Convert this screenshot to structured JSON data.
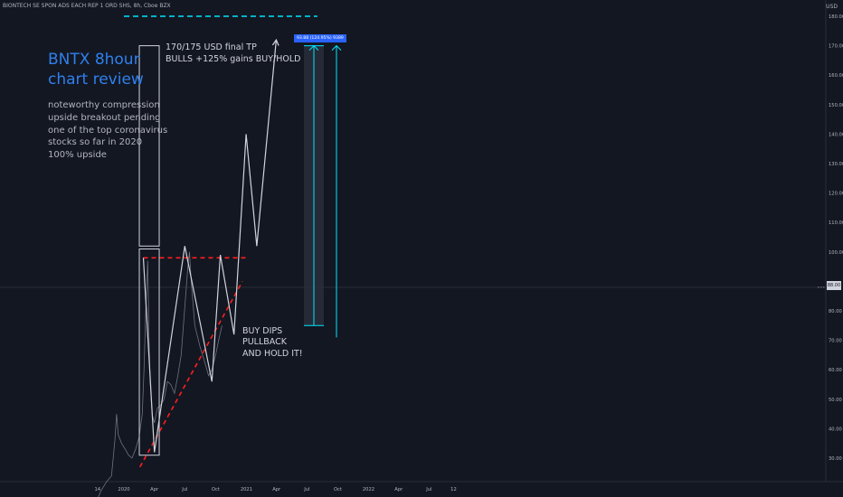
{
  "header": {
    "symbol_title": "BIONTECH SE SPON ADS EACH REP 1 ORD SHS, 8h, Cboe BZX",
    "currency": "USD"
  },
  "annotations": {
    "title": "BNTX 8hour chart review",
    "notes": "noteworthy compression\nupside breakout pending\none of the top coronavirus\nstocks so far in 2020\n100% upside",
    "target": "170/175 USD final TP\nBULLS +125% gains BUY/HOLD",
    "dips": "BUY DIPS\nPULLBACK\nAND HOLD IT!",
    "measure": "93.88 (124.95%) 9389"
  },
  "last_price_label": "88.00",
  "colors": {
    "background": "#131722",
    "text": "#b2b5be",
    "title_blue": "#2f80ed",
    "cyan": "#00e5ff",
    "red_dash": "#ff1f1f",
    "projection": "#d1d4dc",
    "price": "#6f7380"
  },
  "chart_data": {
    "type": "line",
    "y_axis": {
      "ticks": [
        30,
        40,
        50,
        60,
        70,
        80,
        90,
        100,
        110,
        120,
        130,
        140,
        150,
        160,
        170,
        180
      ],
      "tick_labels": [
        "30.00",
        "40.00",
        "50.00",
        "60.00",
        "70.00",
        "80.00",
        "",
        "100.00",
        "110.00",
        "120.00",
        "130.00",
        "140.00",
        "150.00",
        "160.00",
        "170.00",
        "180.00"
      ],
      "ylim": [
        26,
        181
      ]
    },
    "x_axis": {
      "tick_labels": [
        "14",
        "2020",
        "Apr",
        "Jul",
        "Oct",
        "2021",
        "Apr",
        "Jul",
        "Oct",
        "2022",
        "Apr",
        "Jul",
        "12"
      ],
      "tick_dates": [
        "2019-10-14",
        "2020-01-01",
        "2020-04-01",
        "2020-07-01",
        "2020-10-01",
        "2021-01-01",
        "2021-04-01",
        "2021-07-01",
        "2021-10-01",
        "2022-01-01",
        "2022-04-01",
        "2022-07-01",
        "2022-09-12"
      ]
    },
    "grid": false,
    "last_price": 88,
    "series": [
      {
        "values": [
          [
            "2019-10-10",
            15
          ],
          [
            "2019-10-25",
            19
          ],
          [
            "2019-11-10",
            22
          ],
          [
            "2019-11-25",
            24
          ],
          [
            "2019-12-05",
            36
          ],
          [
            "2019-12-10",
            45
          ],
          [
            "2019-12-15",
            38
          ],
          [
            "2019-12-25",
            35
          ],
          [
            "2020-01-05",
            33
          ],
          [
            "2020-01-15",
            31
          ],
          [
            "2020-01-25",
            30
          ],
          [
            "2020-02-05",
            33
          ],
          [
            "2020-02-15",
            37
          ],
          [
            "2020-02-25",
            45
          ],
          [
            "2020-03-01",
            60
          ],
          [
            "2020-03-06",
            80
          ],
          [
            "2020-03-12",
            97
          ],
          [
            "2020-03-16",
            70
          ],
          [
            "2020-03-20",
            55
          ],
          [
            "2020-03-25",
            45
          ],
          [
            "2020-04-01",
            42
          ],
          [
            "2020-04-10",
            47
          ],
          [
            "2020-04-20",
            48
          ],
          [
            "2020-04-30",
            50
          ],
          [
            "2020-05-10",
            56
          ],
          [
            "2020-05-20",
            55
          ],
          [
            "2020-05-31",
            52
          ],
          [
            "2020-06-10",
            58
          ],
          [
            "2020-06-20",
            65
          ],
          [
            "2020-06-30",
            80
          ],
          [
            "2020-07-10",
            95
          ],
          [
            "2020-07-15",
            100
          ],
          [
            "2020-07-20",
            90
          ],
          [
            "2020-07-31",
            75
          ],
          [
            "2020-08-15",
            68
          ],
          [
            "2020-08-31",
            62
          ],
          [
            "2020-09-10",
            58
          ],
          [
            "2020-09-20",
            60
          ],
          [
            "2020-10-01",
            65
          ],
          [
            "2020-10-10",
            70
          ],
          [
            "2020-10-20",
            75
          ]
        ]
      }
    ],
    "support_line": {
      "points": [
        [
          "2020-02-18",
          27
        ],
        [
          "2020-12-20",
          90
        ]
      ]
    },
    "resistance_line": {
      "value": 98,
      "from": "2020-02-28",
      "to": "2020-12-31"
    },
    "target_line": {
      "value": 180,
      "from": "2020-01-01",
      "to": "2021-08-01"
    },
    "projection_path": [
      [
        "2020-02-28",
        98
      ],
      [
        "2020-04-01",
        32
      ],
      [
        "2020-07-01",
        102
      ],
      [
        "2020-09-20",
        56
      ],
      [
        "2020-10-15",
        99
      ],
      [
        "2020-11-25",
        72
      ],
      [
        "2020-12-31",
        140
      ],
      [
        "2021-02-01",
        102
      ],
      [
        "2021-03-31",
        172
      ]
    ]
  }
}
